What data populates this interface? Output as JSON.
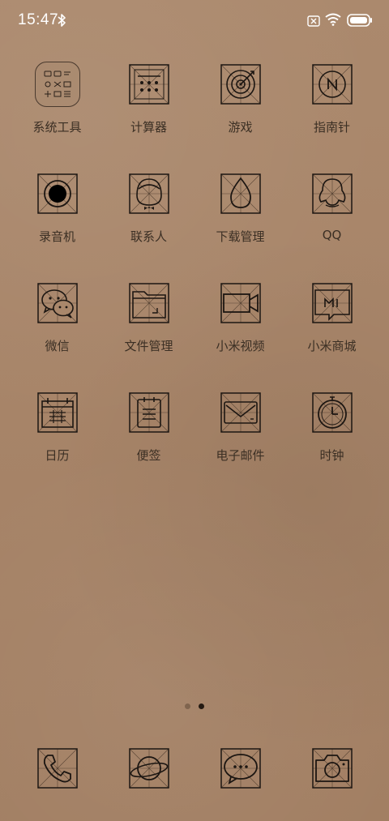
{
  "status_bar": {
    "time": "15:47"
  },
  "apps": [
    {
      "label": "系统工具",
      "icon": "system-tools-folder-icon"
    },
    {
      "label": "计算器",
      "icon": "calculator-icon"
    },
    {
      "label": "游戏",
      "icon": "target-icon"
    },
    {
      "label": "指南针",
      "icon": "compass-icon"
    },
    {
      "label": "录音机",
      "icon": "recorder-icon"
    },
    {
      "label": "联系人",
      "icon": "contacts-icon"
    },
    {
      "label": "下载管理",
      "icon": "download-drop-icon"
    },
    {
      "label": "QQ",
      "icon": "qq-penguin-icon"
    },
    {
      "label": "微信",
      "icon": "wechat-icon"
    },
    {
      "label": "文件管理",
      "icon": "folder-icon"
    },
    {
      "label": "小米视频",
      "icon": "video-camera-icon"
    },
    {
      "label": "小米商城",
      "icon": "mi-store-icon"
    },
    {
      "label": "日历",
      "icon": "calendar-icon"
    },
    {
      "label": "便签",
      "icon": "notes-icon"
    },
    {
      "label": "电子邮件",
      "icon": "mail-icon"
    },
    {
      "label": "时钟",
      "icon": "clock-icon"
    }
  ],
  "dock": [
    {
      "icon": "phone-icon"
    },
    {
      "icon": "browser-planet-icon"
    },
    {
      "icon": "messages-icon"
    },
    {
      "icon": "camera-icon"
    }
  ],
  "pager": {
    "pages": 2,
    "current": 2
  },
  "colors": {
    "background": "#a9876b",
    "icon_stroke": "#1c1612",
    "label_text": "#3b2f24",
    "status_text": "#ffffff"
  }
}
